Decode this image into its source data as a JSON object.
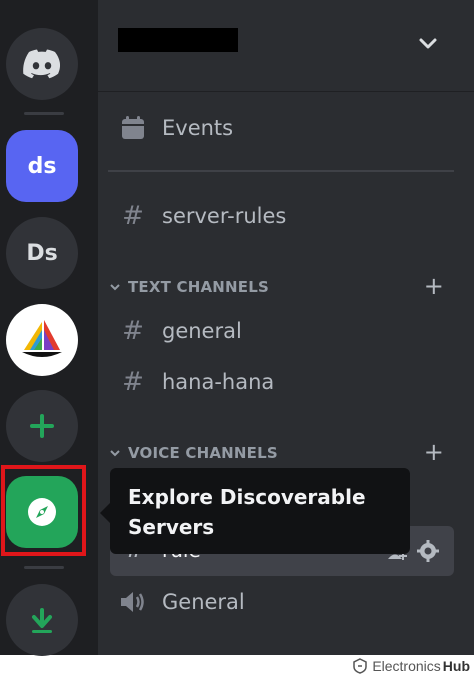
{
  "server_rail": {
    "items": [
      {
        "label": "",
        "kind": "discord-home"
      },
      {
        "label": "ds"
      },
      {
        "label": "Ds"
      },
      {
        "label": "",
        "kind": "midjourney"
      },
      {
        "label": "+",
        "kind": "add-server"
      },
      {
        "label": "",
        "kind": "explore"
      },
      {
        "label": "",
        "kind": "download"
      }
    ]
  },
  "channel_panel": {
    "server_name": "",
    "events_label": "Events",
    "server_rules": "server-rules",
    "text_category": "TEXT CHANNELS",
    "text_channels": [
      "general",
      "hana-hana"
    ],
    "voice_category": "VOICE CHANNELS",
    "selected_channel": "rule",
    "voice_channels": [
      "General"
    ]
  },
  "tooltip": {
    "text": "Explore Discoverable Servers"
  },
  "watermark": {
    "prefix": "Electronics",
    "suffix": "Hub"
  },
  "colors": {
    "accent": "#5865f2",
    "green": "#23a55a",
    "highlight": "#e0161a"
  }
}
